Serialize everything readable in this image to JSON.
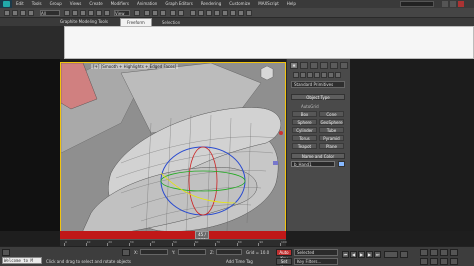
{
  "app": {
    "menu": [
      "Edit",
      "Tools",
      "Group",
      "Views",
      "Create",
      "Modifiers",
      "Animation",
      "Graph Editors",
      "Rendering",
      "Customize",
      "MAXScript",
      "Help"
    ]
  },
  "toolbar": {
    "filter_label": "All",
    "view_label": "View"
  },
  "ribbon": {
    "title": "Graphite Modeling Tools",
    "tabs": [
      {
        "label": "Freeform",
        "active": true
      },
      {
        "label": "Selection",
        "active": false
      }
    ]
  },
  "viewport": {
    "label": "[+] [Smooth + Highlights + Edged Faces]",
    "border_color": "#f1c40f"
  },
  "command_panel": {
    "category": "Standard Primitives",
    "object_type_title": "Object Type",
    "autogrid_label": "AutoGrid",
    "primitives": [
      [
        "Box",
        "Cone"
      ],
      [
        "Sphere",
        "GeoSphere"
      ],
      [
        "Cylinder",
        "Tube"
      ],
      [
        "Torus",
        "Pyramid"
      ],
      [
        "Teapot",
        "Plane"
      ]
    ],
    "name_color_title": "Name and Color",
    "name_value": "b_Hand1",
    "swatch_color": "#87b9ff"
  },
  "timeline": {
    "slider_label": "45 / 100",
    "ticks": [
      "0",
      "10",
      "20",
      "30",
      "40",
      "50",
      "60",
      "70",
      "80",
      "90",
      "100"
    ],
    "bar_color": "#c01818"
  },
  "status": {
    "maxscript_text": "Welcome to M",
    "prompt": "Click and drag to select and rotate objects",
    "x_label": "X:",
    "y_label": "Y:",
    "z_label": "Z:",
    "grid_label": "Grid = 10.0",
    "add_time_tag": "Add Time Tag",
    "auto_key": "Auto Key",
    "set_key": "Set Key",
    "selected": "Selected",
    "key_filters": "Key Filters..."
  }
}
